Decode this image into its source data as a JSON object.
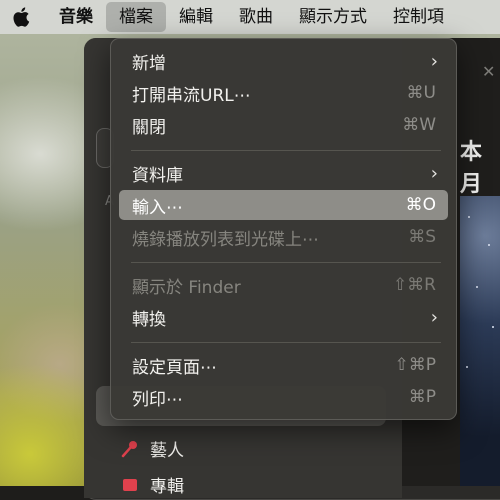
{
  "menubar": {
    "items": [
      {
        "label": "音樂"
      },
      {
        "label": "檔案"
      },
      {
        "label": "編輯"
      },
      {
        "label": "歌曲"
      },
      {
        "label": "顯示方式"
      },
      {
        "label": "控制項"
      }
    ]
  },
  "file_menu": {
    "items": [
      {
        "label": "新增",
        "submenu": true
      },
      {
        "label": "打開串流URL⋯",
        "shortcut": "⌘U"
      },
      {
        "label": "關閉",
        "shortcut": "⌘W"
      },
      {
        "label": "資料庫",
        "submenu": true
      },
      {
        "label": "輸入⋯",
        "shortcut": "⌘O",
        "highlighted": true
      },
      {
        "label": "燒錄播放列表到光碟上⋯",
        "shortcut": "⌘S",
        "disabled": true
      },
      {
        "label": "顯示於 Finder",
        "shortcut": "⇧⌘R",
        "disabled": true
      },
      {
        "label": "轉換",
        "submenu": true
      },
      {
        "label": "設定頁面⋯",
        "shortcut": "⇧⌘P"
      },
      {
        "label": "列印⋯",
        "shortcut": "⌘P"
      }
    ]
  },
  "window": {
    "content_title": "本月",
    "sidebar_letter": "A",
    "sidebar_items": [
      {
        "label": "藝人",
        "icon": "microphone-icon"
      },
      {
        "label": "專輯",
        "icon": "album-icon"
      }
    ]
  },
  "colors": {
    "menubar": "#d4d6d1",
    "menu_bg": "#3a3936",
    "highlight": "#8e8d88",
    "accent_icon": "#e0414d"
  }
}
